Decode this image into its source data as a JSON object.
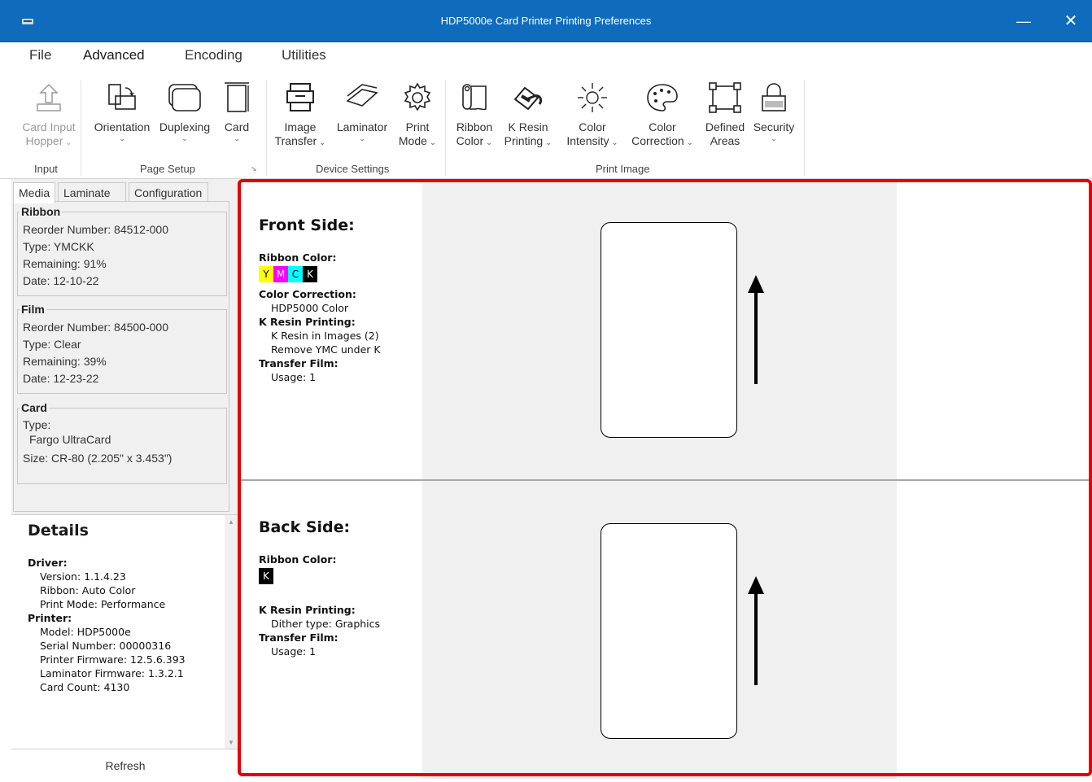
{
  "window": {
    "title": "HDP5000e Card Printer Printing Preferences",
    "minimize": "—",
    "close": "✕"
  },
  "menu": [
    "File",
    "Advanced",
    "Encoding",
    "Utilities"
  ],
  "ribbon": {
    "buttons": [
      {
        "label1": "Card Input",
        "label2": "Hopper",
        "icon": "card-hopper-icon",
        "chev": "inline",
        "disabled": true
      },
      {
        "label1": "Orientation",
        "label2": "",
        "icon": "orientation-icon",
        "chev": "below"
      },
      {
        "label1": "Duplexing",
        "label2": "",
        "icon": "duplexing-icon",
        "chev": "below"
      },
      {
        "label1": "Card",
        "label2": "",
        "icon": "card-icon",
        "chev": "below"
      },
      {
        "label1": "Image",
        "label2": "Transfer",
        "icon": "image-transfer-icon",
        "chev": "inline"
      },
      {
        "label1": "Laminator",
        "label2": "",
        "icon": "laminator-icon",
        "chev": "below"
      },
      {
        "label1": "Print",
        "label2": "Mode",
        "icon": "print-mode-gear-icon",
        "chev": "inline"
      },
      {
        "label1": "Ribbon",
        "label2": "Color",
        "icon": "ribbon-roll-icon",
        "chev": "inline"
      },
      {
        "label1": "K Resin",
        "label2": "Printing",
        "icon": "k-resin-paint-icon",
        "chev": "inline"
      },
      {
        "label1": "Color",
        "label2": "Intensity",
        "icon": "sun-intensity-icon",
        "chev": "inline"
      },
      {
        "label1": "Color",
        "label2": "Correction",
        "icon": "palette-icon",
        "chev": "inline"
      },
      {
        "label1": "Defined",
        "label2": "Areas",
        "icon": "defined-areas-icon",
        "chev": "none"
      },
      {
        "label1": "Security",
        "label2": "",
        "icon": "security-lock-icon",
        "chev": "below"
      }
    ],
    "groups": [
      "Input",
      "Page Setup",
      "Device Settings",
      "Print Image"
    ],
    "chevron": "⌄",
    "launcher": "↘"
  },
  "tabs": [
    "Media",
    "Laminate",
    "Configuration"
  ],
  "media": {
    "ribbon": {
      "legend": "Ribbon",
      "rows": [
        "Reorder Number: 84512-000",
        "Type: YMCKK",
        "Remaining: 91%",
        "Date: 12-10-22"
      ]
    },
    "film": {
      "legend": "Film",
      "rows": [
        "Reorder Number: 84500-000",
        "Type: Clear",
        "Remaining: 39%",
        "Date: 12-23-22"
      ]
    },
    "card": {
      "legend": "Card",
      "rows": [
        "Type:",
        "Fargo UltraCard",
        "Size: CR-80 (2.205\" x 3.453\")"
      ]
    }
  },
  "details": {
    "title": "Details",
    "lines": [
      {
        "t": "Driver:",
        "h": true
      },
      {
        "t": "Version: 1.1.4.23"
      },
      {
        "t": "Ribbon: Auto Color"
      },
      {
        "t": "Print Mode: Performance"
      },
      {
        "t": "Printer:",
        "h": true
      },
      {
        "t": "Model: HDP5000e"
      },
      {
        "t": "Serial Number: 00000316"
      },
      {
        "t": "Printer Firmware: 12.5.6.393"
      },
      {
        "t": "Laminator Firmware: 1.3.2.1"
      },
      {
        "t": "Card Count: 4130"
      }
    ],
    "refresh": "Refresh"
  },
  "front": {
    "title": "Front Side:",
    "ribbon_label": "Ribbon Color:",
    "swatches": [
      {
        "t": "Y",
        "bg": "#ffff00",
        "fg": "#000000"
      },
      {
        "t": "M",
        "bg": "#ff00ff",
        "fg": "#ffffff"
      },
      {
        "t": "C",
        "bg": "#00ffff",
        "fg": "#000000"
      },
      {
        "t": "K",
        "bg": "#000000",
        "fg": "#ffffff"
      }
    ],
    "lines": [
      {
        "t": "Color Correction:",
        "h": true
      },
      {
        "t": "HDP5000 Color"
      },
      {
        "t": "K Resin Printing:",
        "h": true
      },
      {
        "t": "K Resin in Images (2)"
      },
      {
        "t": "Remove YMC under K"
      },
      {
        "t": "Transfer Film:",
        "h": true
      },
      {
        "t": "Usage: 1"
      }
    ]
  },
  "back": {
    "title": "Back Side:",
    "ribbon_label": "Ribbon Color:",
    "swatches": [
      {
        "t": "K",
        "bg": "#000000",
        "fg": "#ffffff"
      }
    ],
    "lines": [
      {
        "t": "",
        "h": false
      },
      {
        "t": "K Resin Printing:",
        "h": true
      },
      {
        "t": "Dither type: Graphics"
      },
      {
        "t": "Transfer Film:",
        "h": true
      },
      {
        "t": "Usage: 1"
      }
    ]
  }
}
